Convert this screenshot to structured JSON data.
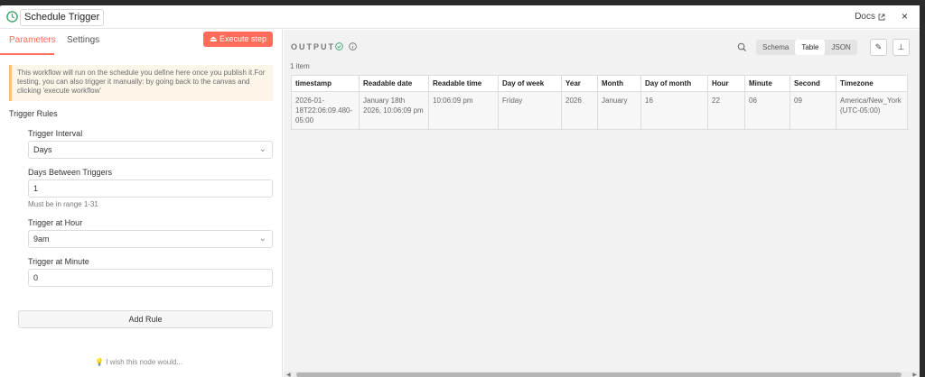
{
  "header": {
    "title": "Schedule Trigger",
    "docs_label": "Docs",
    "close_symbol": "×"
  },
  "left_panel": {
    "tabs": [
      {
        "label": "Parameters",
        "active": true
      },
      {
        "label": "Settings",
        "active": false
      }
    ],
    "execute_button": "Execute step",
    "notice": "This workflow will run on the schedule you define here once you publish it.For testing, you can also trigger it manually: by going back to the canvas and clicking 'execute workflow'",
    "section_title": "Trigger Rules",
    "fields": {
      "interval_label": "Trigger Interval",
      "interval_value": "Days",
      "days_label": "Days Between Triggers",
      "days_value": "1",
      "days_hint": "Must be in range 1-31",
      "hour_label": "Trigger at Hour",
      "hour_value": "9am",
      "minute_label": "Trigger at Minute",
      "minute_value": "0"
    },
    "add_rule_button": "Add Rule",
    "feedback_link": "I wish this node would..."
  },
  "output_panel": {
    "title": "OUTPUT",
    "view_tabs": [
      {
        "label": "Schema",
        "active": false
      },
      {
        "label": "Table",
        "active": true
      },
      {
        "label": "JSON",
        "active": false
      }
    ],
    "item_count": "1 item",
    "columns": [
      "timestamp",
      "Readable date",
      "Readable time",
      "Day of week",
      "Year",
      "Month",
      "Day of month",
      "Hour",
      "Minute",
      "Second",
      "Timezone"
    ],
    "rows": [
      [
        "2026-01-18T22:06:09.480-05:00",
        "January 18th 2026, 10:06:09 pm",
        "10:06:09 pm",
        "Friday",
        "2026",
        "January",
        "16",
        "22",
        "06",
        "09",
        "America/New_York (UTC-05:00)"
      ]
    ]
  },
  "colors": {
    "accent": "#ff6d5a",
    "success": "#3aa86b"
  }
}
